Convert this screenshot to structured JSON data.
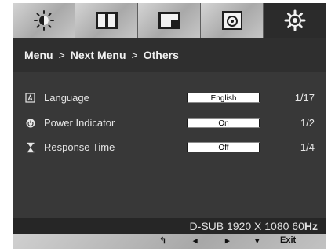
{
  "tabs": [
    {
      "icon": "brightness-icon"
    },
    {
      "icon": "picture-icon"
    },
    {
      "icon": "screen-icon"
    },
    {
      "icon": "disc-icon"
    },
    {
      "icon": "settings-gear-icon"
    }
  ],
  "breadcrumb": {
    "level1": "Menu",
    "level2": "Next Menu",
    "level3": "Others",
    "separator": ">"
  },
  "settings": [
    {
      "icon": "language-icon",
      "label": "Language",
      "value": "English",
      "count": "1/17"
    },
    {
      "icon": "power-indicator-icon",
      "label": "Power Indicator",
      "value": "On",
      "count": "1/2"
    },
    {
      "icon": "hourglass-icon",
      "label": "Response Time",
      "value": "Off",
      "count": "1/4"
    }
  ],
  "status": {
    "mode": "D-SUB 1920 X 1080 60",
    "unit": "Hz"
  },
  "nav": {
    "back_icon": "↰",
    "left_icon": "◂",
    "right_icon": "▸",
    "down_icon": "▾",
    "exit_label": "Exit"
  },
  "colors": {
    "panel": "#2b2b2b",
    "content": "#383838",
    "tab_inactive": "#b8b8b8"
  }
}
